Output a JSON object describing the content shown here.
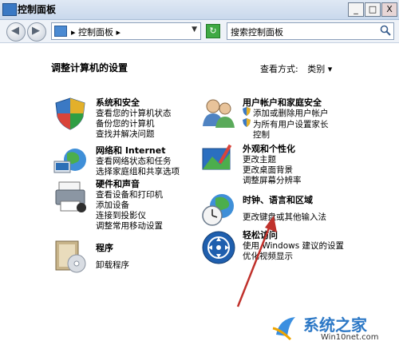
{
  "window": {
    "title": "控制面板",
    "buttons": [
      "_",
      "□",
      "X"
    ]
  },
  "nav": {
    "address": "▸ 控制面板 ▸",
    "search_placeholder": "搜索控制面板"
  },
  "content": {
    "heading": "调整计算机的设置",
    "view_by_label": "查看方式:",
    "view_by_value": "类别 ▾",
    "categories": [
      {
        "title": "系统和安全",
        "links": [
          "查看您的计算机状态",
          "备份您的计算机",
          "查找并解决问题"
        ]
      },
      {
        "title": "网络和 Internet",
        "links": [
          "查看网络状态和任务",
          "选择家庭组和共享选项"
        ]
      },
      {
        "title": "硬件和声音",
        "links": [
          "查看设备和打印机",
          "添加设备",
          "连接到投影仪",
          "调整常用移动设置"
        ]
      },
      {
        "title": "程序",
        "links": [
          "卸载程序"
        ]
      },
      {
        "title": "用户帐户和家庭安全",
        "links": [
          "添加或删除用户帐户",
          "为所有用户设置家长",
          "控制"
        ]
      },
      {
        "title": "外观和个性化",
        "links": [
          "更改主题",
          "更改桌面背景",
          "调整屏幕分辨率"
        ]
      },
      {
        "title": "时钟、语言和区域",
        "links": [
          "更改键盘或其他输入法"
        ]
      },
      {
        "title": "轻松访问",
        "links": [
          "使用 Windows 建议的设置",
          "优化视频显示"
        ]
      }
    ]
  },
  "watermark": {
    "name": "系统之家",
    "site": "Win10net.com"
  },
  "colors": {
    "arrow": "#c0312b",
    "brand": "#2c78c6"
  }
}
